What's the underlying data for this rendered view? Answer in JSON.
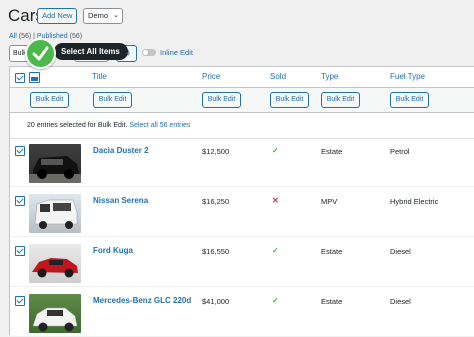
{
  "header": {
    "title": "Cars",
    "add_new_label": "Add New",
    "view_select": "Demo"
  },
  "filters": {
    "all_label": "All",
    "all_count": "(56)",
    "separator": " | ",
    "published_label": "Published",
    "published_count": "(56)"
  },
  "toolbar": {
    "bulk_select": "Bulk",
    "inline_edit_label": "Inline Edit",
    "tooltip": "Select All Items"
  },
  "columns": [
    "Title",
    "Price",
    "Sold",
    "Type",
    "Fuel Type"
  ],
  "bulk_edit_label": "Bulk Edit",
  "selection": {
    "text": "20 entries selected for Bulk Edit.",
    "link": "Select all 56 entries"
  },
  "rows": [
    {
      "title": "Dacia Duster 2",
      "price": "$12,500",
      "sold": "✓",
      "type": "Estate",
      "fuel": "Petrol"
    },
    {
      "title": "Nissan Serena",
      "price": "$16,250",
      "sold": "✕",
      "type": "MPV",
      "fuel": "Hybrid Electric"
    },
    {
      "title": "Ford Kuga",
      "price": "$16,550",
      "sold": "✓",
      "type": "Estate",
      "fuel": "Diesel"
    },
    {
      "title": "Mercedes-Benz GLC 220d",
      "price": "$41,000",
      "sold": "✓",
      "type": "Estate",
      "fuel": "Diesel"
    }
  ],
  "colors": {
    "accent": "#2271b1",
    "success": "#46b450",
    "danger": "#d63638",
    "badge": "#4ab94a"
  },
  "icons": {
    "sold_yes": "check-icon",
    "sold_no": "cross-icon",
    "settings": "gear-icon",
    "column_toggle": "image-column-icon"
  }
}
